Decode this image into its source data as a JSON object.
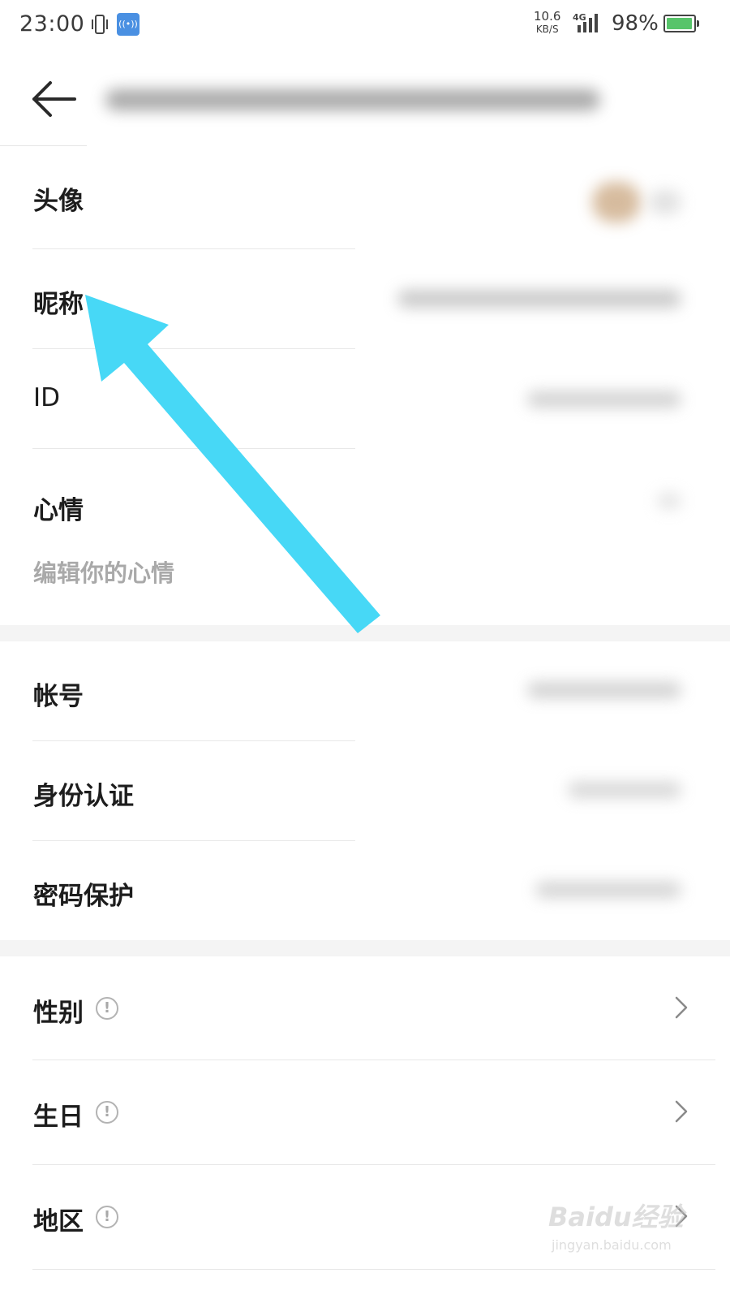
{
  "status_bar": {
    "time": "23:00",
    "net_speed": "10.6",
    "net_speed_unit": "KB/S",
    "network_type": "4G",
    "battery_percent": "98%",
    "battery_level": 0.98,
    "icons": [
      "vibrate-icon",
      "hotspot-icon",
      "signal-icon",
      "battery-icon"
    ]
  },
  "header": {
    "back_icon": "back-arrow-icon"
  },
  "profile_rows": [
    {
      "label": "头像"
    },
    {
      "label": "昵称"
    },
    {
      "label": "ID"
    },
    {
      "label": "心情",
      "sub": "编辑你的心情"
    }
  ],
  "account_rows": [
    {
      "label": "帐号"
    },
    {
      "label": "身份认证"
    },
    {
      "label": "密码保护"
    }
  ],
  "info_rows": [
    {
      "label": "性别",
      "icon": "info-icon"
    },
    {
      "label": "生日",
      "icon": "info-icon"
    },
    {
      "label": "地区",
      "icon": "info-icon"
    }
  ],
  "annotation": {
    "type": "arrow",
    "color": "#47d8f6",
    "points_to": "昵称"
  },
  "watermark": {
    "logo": "Baidu经验",
    "url": "jingyan.baidu.com"
  },
  "colors": {
    "divider": "#e8e8e8",
    "section_gap": "#f4f4f4",
    "subtext": "#a9a9a9",
    "battery": "#57c46a",
    "hotspot": "#4a90e2"
  }
}
